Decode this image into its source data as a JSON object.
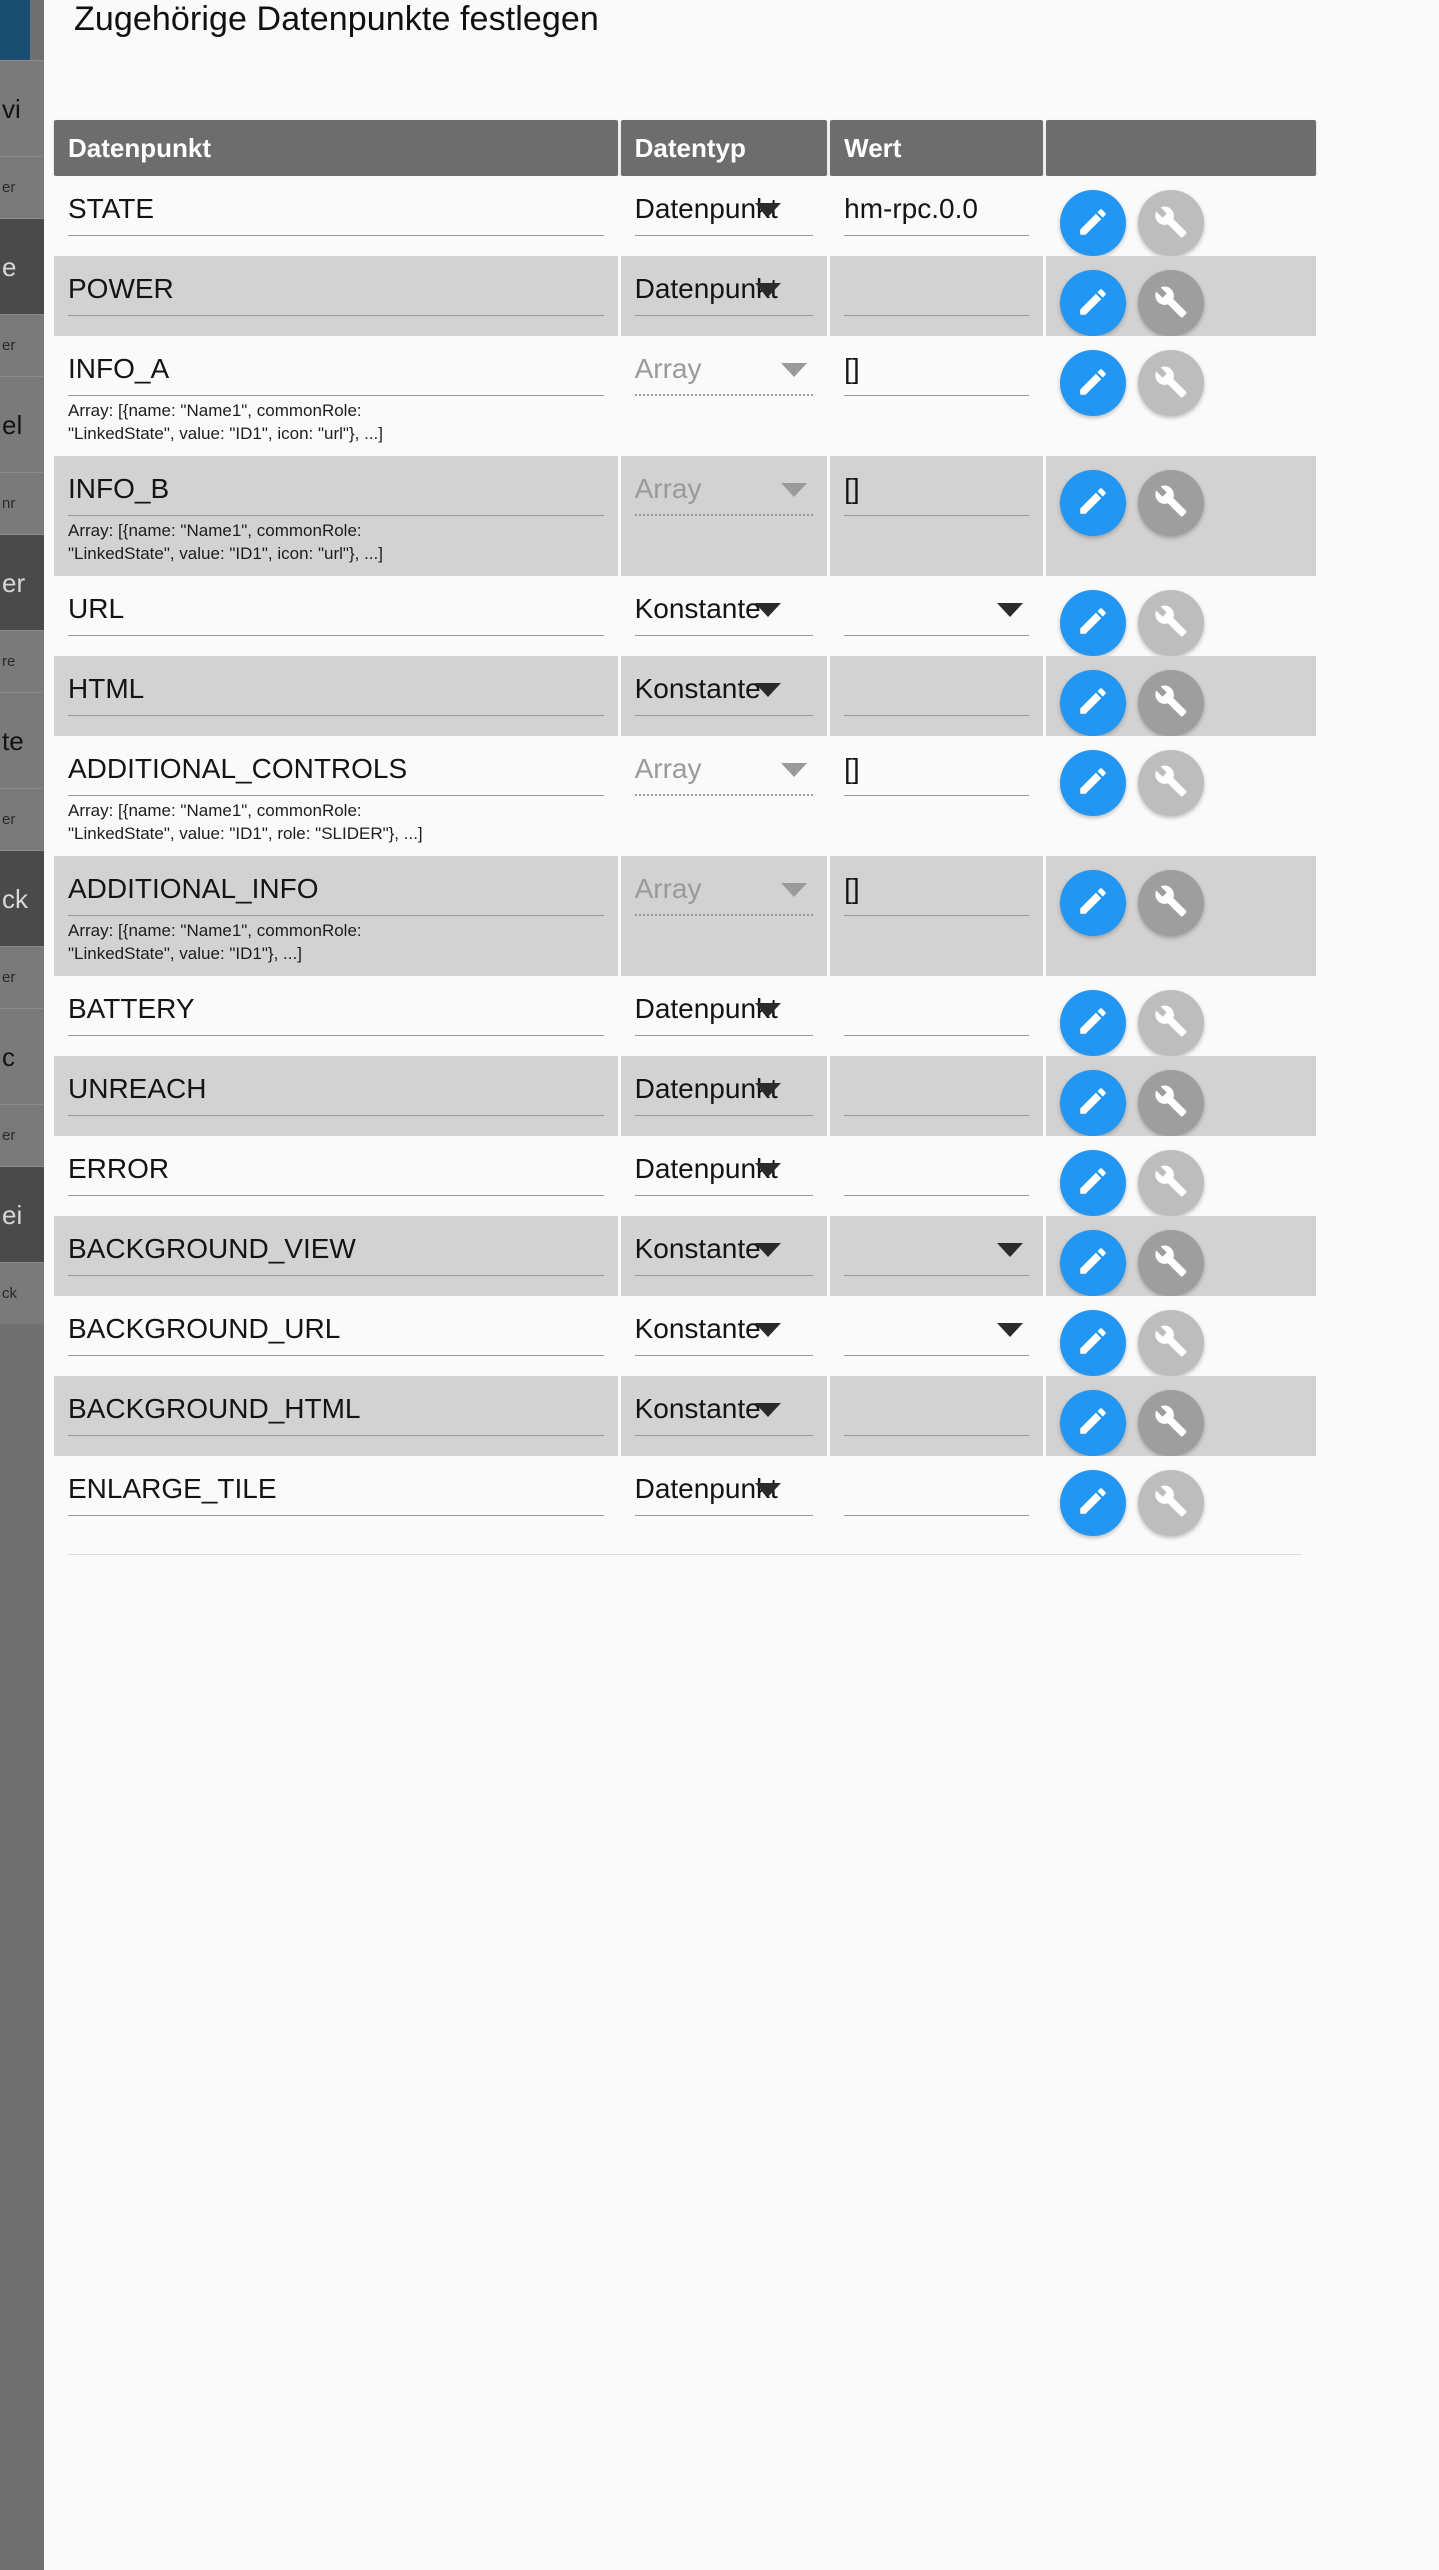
{
  "dialog": {
    "title": "Zugehörige Datenpunkte festlegen"
  },
  "table": {
    "headers": [
      "Datenpunkt",
      "Datentyp",
      "Wert",
      ""
    ],
    "rows": [
      {
        "name": "STATE",
        "type": "Datenpunkt",
        "type_muted": false,
        "type_caret": true,
        "value": "hm-rpc.0.0",
        "value_caret": false,
        "hint": ""
      },
      {
        "name": "POWER",
        "type": "Datenpunkt",
        "type_muted": false,
        "type_caret": true,
        "value": "",
        "value_caret": false,
        "hint": ""
      },
      {
        "name": "INFO_A",
        "type": "Array",
        "type_muted": true,
        "type_caret": true,
        "value": "[]",
        "value_caret": false,
        "hint": "Array: [{name: \"Name1\", commonRole:\n\"LinkedState\", value: \"ID1\", icon: \"url\"}, ...]"
      },
      {
        "name": "INFO_B",
        "type": "Array",
        "type_muted": true,
        "type_caret": true,
        "value": "[]",
        "value_caret": false,
        "hint": "Array: [{name: \"Name1\", commonRole:\n\"LinkedState\", value: \"ID1\", icon: \"url\"}, ...]"
      },
      {
        "name": "URL",
        "type": "Konstante",
        "type_muted": false,
        "type_caret": true,
        "value": "",
        "value_caret": true,
        "hint": ""
      },
      {
        "name": "HTML",
        "type": "Konstante",
        "type_muted": false,
        "type_caret": true,
        "value": "",
        "value_caret": false,
        "hint": ""
      },
      {
        "name": "ADDITIONAL_CONTROLS",
        "type": "Array",
        "type_muted": true,
        "type_caret": true,
        "value": "[]",
        "value_caret": false,
        "hint": "Array: [{name: \"Name1\", commonRole:\n\"LinkedState\", value: \"ID1\", role: \"SLIDER\"}, ...]"
      },
      {
        "name": "ADDITIONAL_INFO",
        "type": "Array",
        "type_muted": true,
        "type_caret": true,
        "value": "[]",
        "value_caret": false,
        "hint": "Array: [{name: \"Name1\", commonRole:\n\"LinkedState\", value: \"ID1\"}, ...]"
      },
      {
        "name": "BATTERY",
        "type": "Datenpunkt",
        "type_muted": false,
        "type_caret": true,
        "value": "",
        "value_caret": false,
        "hint": ""
      },
      {
        "name": "UNREACH",
        "type": "Datenpunkt",
        "type_muted": false,
        "type_caret": true,
        "value": "",
        "value_caret": false,
        "hint": ""
      },
      {
        "name": "ERROR",
        "type": "Datenpunkt",
        "type_muted": false,
        "type_caret": true,
        "value": "",
        "value_caret": false,
        "hint": ""
      },
      {
        "name": "BACKGROUND_VIEW",
        "type": "Konstante",
        "type_muted": false,
        "type_caret": true,
        "value": "",
        "value_caret": true,
        "hint": ""
      },
      {
        "name": "BACKGROUND_URL",
        "type": "Konstante",
        "type_muted": false,
        "type_caret": true,
        "value": "",
        "value_caret": true,
        "hint": ""
      },
      {
        "name": "BACKGROUND_HTML",
        "type": "Konstante",
        "type_muted": false,
        "type_caret": true,
        "value": "",
        "value_caret": false,
        "hint": ""
      },
      {
        "name": "ENLARGE_TILE",
        "type": "Datenpunkt",
        "type_muted": false,
        "type_caret": true,
        "value": "",
        "value_caret": false,
        "hint": ""
      }
    ],
    "actions": {
      "edit_icon": "pencil-icon",
      "settings_icon": "wrench-icon"
    }
  },
  "background": {
    "fragments": [
      "vi",
      "er",
      "e",
      "er",
      "el",
      "nr",
      "er",
      "re",
      "te",
      "er",
      "ck",
      "er",
      "c",
      "er",
      "ei",
      "ck"
    ]
  },
  "colors": {
    "accent": "#2196f3",
    "header_bg": "#6d6d6d",
    "row_alt_bg": "#d2d2d2",
    "dialog_bg": "#fafafa",
    "backdrop": "#707070"
  }
}
